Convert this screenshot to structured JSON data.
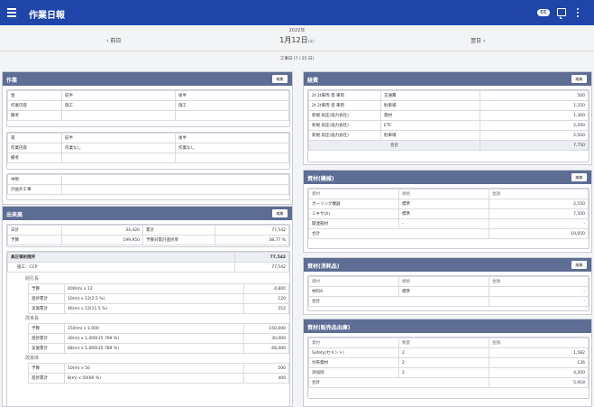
{
  "app": {
    "title": "作業日報"
  },
  "header": {
    "cc": "CC"
  },
  "date": {
    "year": "2022年",
    "prev": "前日",
    "main": "1月12日",
    "weekday": "(水)",
    "next": "翌日",
    "workday": "工事日 (7 / 25 日)"
  },
  "edit_label": "編集",
  "sagyo": {
    "title": "作業",
    "blocks": [
      {
        "rows": [
          [
            "昼",
            "前半",
            "後半"
          ],
          [
            "作業内容",
            "施工",
            "施工"
          ],
          [
            "備考",
            "",
            ""
          ]
        ]
      },
      {
        "rows": [
          [
            "夜",
            "前半",
            "後半"
          ],
          [
            "作業内容",
            "作業なし",
            "作業なし"
          ],
          [
            "備考",
            "",
            ""
          ]
        ]
      },
      {
        "rows": [
          [
            "中断",
            ""
          ],
          [
            "計画外工事",
            ""
          ]
        ]
      }
    ]
  },
  "shukko": {
    "title": "出来高",
    "summary": [
      [
        "日計",
        "34,420",
        "累計",
        "77,542"
      ],
      [
        "予算",
        "199,950",
        "予算対累計進捗率",
        "38.77 %"
      ]
    ],
    "total_label": "高圧噴射撹拌",
    "total_value": "77,542",
    "method_label": "施工：CCP",
    "method_value": "77,542",
    "groups": [
      {
        "name": "削孔長",
        "rows": [
          [
            "予算",
            "400(m) x 12",
            "4,800"
          ],
          [
            "進捗累計",
            "10(m) x 12(2.5 %)",
            "120"
          ],
          [
            "実施累計",
            "46(m) x 12(11.5 %)",
            "552"
          ]
        ]
      },
      {
        "name": "改良長",
        "rows": [
          [
            "予算",
            "150(m) x 1,000",
            "150,000"
          ],
          [
            "進捗累計",
            "30(m) x 1,000(15.799 %)",
            "30,000"
          ],
          [
            "実施累計",
            "68(m) x 1,000(35.789 %)",
            "68,000"
          ]
        ]
      },
      {
        "name": "改良体",
        "rows": [
          [
            "予算",
            "10(m) x 50",
            "500"
          ],
          [
            "進捗累計",
            "8(m) x 50(80 %)",
            "400"
          ]
        ]
      }
    ]
  },
  "keihi": {
    "title": "経費",
    "rows": [
      [
        "2t 2t車両 借 車両",
        "交通費",
        "500"
      ],
      [
        "2t 2t車両 借 車両",
        "駐車場",
        "1,250"
      ],
      [
        "新規 高圧(協力会社)",
        "資材",
        "1,300"
      ],
      [
        "新規 高圧(協力会社)",
        "ETC",
        "2,200"
      ],
      [
        "新規 高圧(協力会社)",
        "駐車場",
        "2,500"
      ]
    ],
    "total_label": "合計",
    "total_value": "7,750"
  },
  "shizai_kikai": {
    "title": "資材(機械)",
    "header": [
      "資材",
      "規格",
      "金額"
    ],
    "rows": [
      [
        "ボーリング機器",
        "標準",
        "2,550"
      ],
      [
        "ミキサ(A)",
        "標準",
        "7,500"
      ],
      [
        "関連部材",
        "-",
        "-"
      ]
    ],
    "total_label": "合計",
    "total_value": "10,050"
  },
  "shizai_shomo": {
    "title": "資材(消耗品)",
    "header": [
      "資材",
      "規格",
      "金額"
    ],
    "rows": [
      [
        "材料A",
        "標準",
        "-"
      ]
    ],
    "total_label": "合計",
    "total_value": "-"
  },
  "shizai_hanbai": {
    "title": "資材(販売品出庫)",
    "header": [
      "資材",
      "数量",
      "金額"
    ],
    "rows": [
      [
        "Safety(セメント)",
        "2",
        "1,582"
      ],
      [
        "付帯資材",
        "2",
        "136"
      ],
      [
        "添加剤",
        "2",
        "4,200"
      ]
    ],
    "total_label": "合計",
    "total_value": "5,918"
  }
}
